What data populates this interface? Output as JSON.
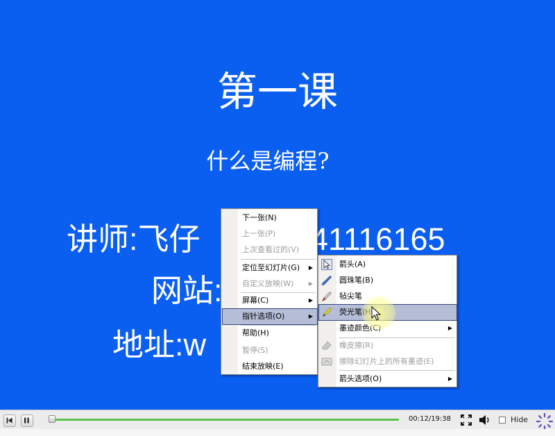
{
  "slide": {
    "title": "第一课",
    "subtitle": "什么是编程?",
    "teacher": "讲师:飞仔",
    "qq_partial": "41116165",
    "website": "网站:",
    "address": "地址:w"
  },
  "context_menu": {
    "items": [
      {
        "label": "下一张(N)",
        "enabled": true
      },
      {
        "label": "上一张(P)",
        "enabled": false
      },
      {
        "label": "上次查看过的(V)",
        "enabled": false
      },
      {
        "label": "定位至幻灯片(G)",
        "enabled": true,
        "submenu": true
      },
      {
        "label": "自定义放映(W)",
        "enabled": false,
        "submenu": true
      },
      {
        "label": "屏幕(C)",
        "enabled": true,
        "submenu": true
      },
      {
        "label": "指针选项(O)",
        "enabled": true,
        "submenu": true,
        "highlighted": true
      },
      {
        "label": "帮助(H)",
        "enabled": true
      },
      {
        "label": "暂停(S)",
        "enabled": false
      },
      {
        "label": "结束放映(E)",
        "enabled": true
      }
    ]
  },
  "pointer_menu": {
    "items": [
      {
        "label": "箭头(A)",
        "icon": "arrow-pointer-icon",
        "enabled": true,
        "checked": true
      },
      {
        "label": "圆珠笔(B)",
        "icon": "ballpoint-pen-icon",
        "enabled": true
      },
      {
        "label": "毡尖笔",
        "icon": "felt-tip-pen-icon",
        "enabled": true
      },
      {
        "label": "荧光笔(H)",
        "icon": "highlighter-icon",
        "enabled": true,
        "highlighted": true
      },
      {
        "label": "墨迹颜色(C)",
        "enabled": true,
        "submenu": true
      },
      {
        "label": "橡皮擦(R)",
        "icon": "eraser-icon",
        "enabled": false
      },
      {
        "label": "擦除幻灯片上的所有墨迹(E)",
        "icon": "erase-all-ink-icon",
        "enabled": false
      },
      {
        "label": "箭头选项(O)",
        "enabled": true,
        "submenu": true
      }
    ]
  },
  "player": {
    "time": "00:12/19:38",
    "hide_label": "Hide",
    "progress": 0.0102,
    "hide_checked": false
  },
  "colors": {
    "slide_bg": "#0a5ef0",
    "progress_green": "#5bbf4b",
    "menu_highlight": "#b5bed6"
  }
}
